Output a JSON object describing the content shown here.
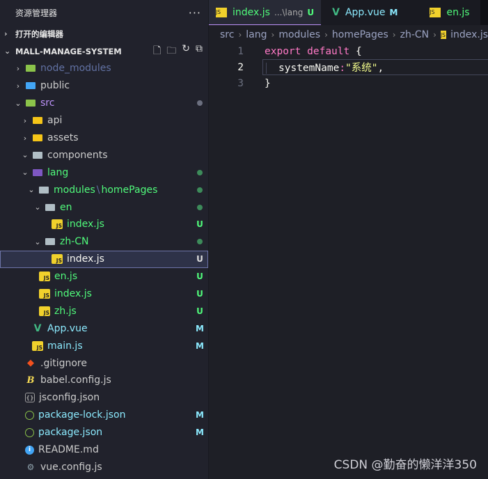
{
  "sidebar": {
    "title": "资源管理器",
    "more": "···",
    "open_editors": "打开的编辑器",
    "root": "MALL-MANAGE-SYSTEM",
    "tree": [
      {
        "label": "node_modules",
        "chev": "›",
        "badge": ""
      },
      {
        "label": "public",
        "chev": "›",
        "badge": ""
      },
      {
        "label": "src",
        "chev": "⌄",
        "badge": "dot-gray"
      },
      {
        "label": "api",
        "chev": "›",
        "badge": ""
      },
      {
        "label": "assets",
        "chev": "›",
        "badge": ""
      },
      {
        "label": "components",
        "chev": "⌄",
        "badge": ""
      },
      {
        "label": "lang",
        "chev": "⌄",
        "badge": "dot"
      },
      {
        "label": "modules",
        "label2": "homePages",
        "sep": "\\",
        "chev": "⌄",
        "badge": "dot"
      },
      {
        "label": "en",
        "chev": "⌄",
        "badge": "dot"
      },
      {
        "label": "index.js",
        "badge": "U"
      },
      {
        "label": "zh-CN",
        "chev": "⌄",
        "badge": "dot"
      },
      {
        "label": "index.js",
        "badge": "U"
      },
      {
        "label": "en.js",
        "badge": "U"
      },
      {
        "label": "index.js",
        "badge": "U"
      },
      {
        "label": "zh.js",
        "badge": "U"
      },
      {
        "label": "App.vue",
        "badge": "M"
      },
      {
        "label": "main.js",
        "badge": "M"
      },
      {
        "label": ".gitignore",
        "badge": ""
      },
      {
        "label": "babel.config.js",
        "badge": ""
      },
      {
        "label": "jsconfig.json",
        "badge": ""
      },
      {
        "label": "package-lock.json",
        "badge": "M"
      },
      {
        "label": "package.json",
        "badge": "M"
      },
      {
        "label": "README.md",
        "badge": ""
      },
      {
        "label": "vue.config.js",
        "badge": ""
      }
    ]
  },
  "tabs": [
    {
      "label": "index.js",
      "hint": "...\\lang",
      "badge": "U"
    },
    {
      "label": "App.vue",
      "badge": "M"
    },
    {
      "label": "en.js"
    }
  ],
  "breadcrumb": [
    "src",
    "lang",
    "modules",
    "homePages",
    "zh-CN",
    "index.js"
  ],
  "editor": {
    "lines": [
      {
        "n": "1",
        "kw1": "export",
        "kw2": "default",
        "rest": " {"
      },
      {
        "n": "2",
        "key": "systemName",
        "colon": ":",
        "str": "\"系统\"",
        "end": ","
      },
      {
        "n": "3",
        "rest": "}"
      }
    ]
  },
  "icons": {
    "js": "JS",
    "vue": "V",
    "json": "{}",
    "info": "i",
    "git": "◆",
    "babel": "B"
  },
  "watermark": "CSDN @勤奋的懒洋洋350",
  "colors": {
    "accent": "#bd93f9",
    "untracked": "#50fa7b",
    "modified": "#8be9fd"
  }
}
